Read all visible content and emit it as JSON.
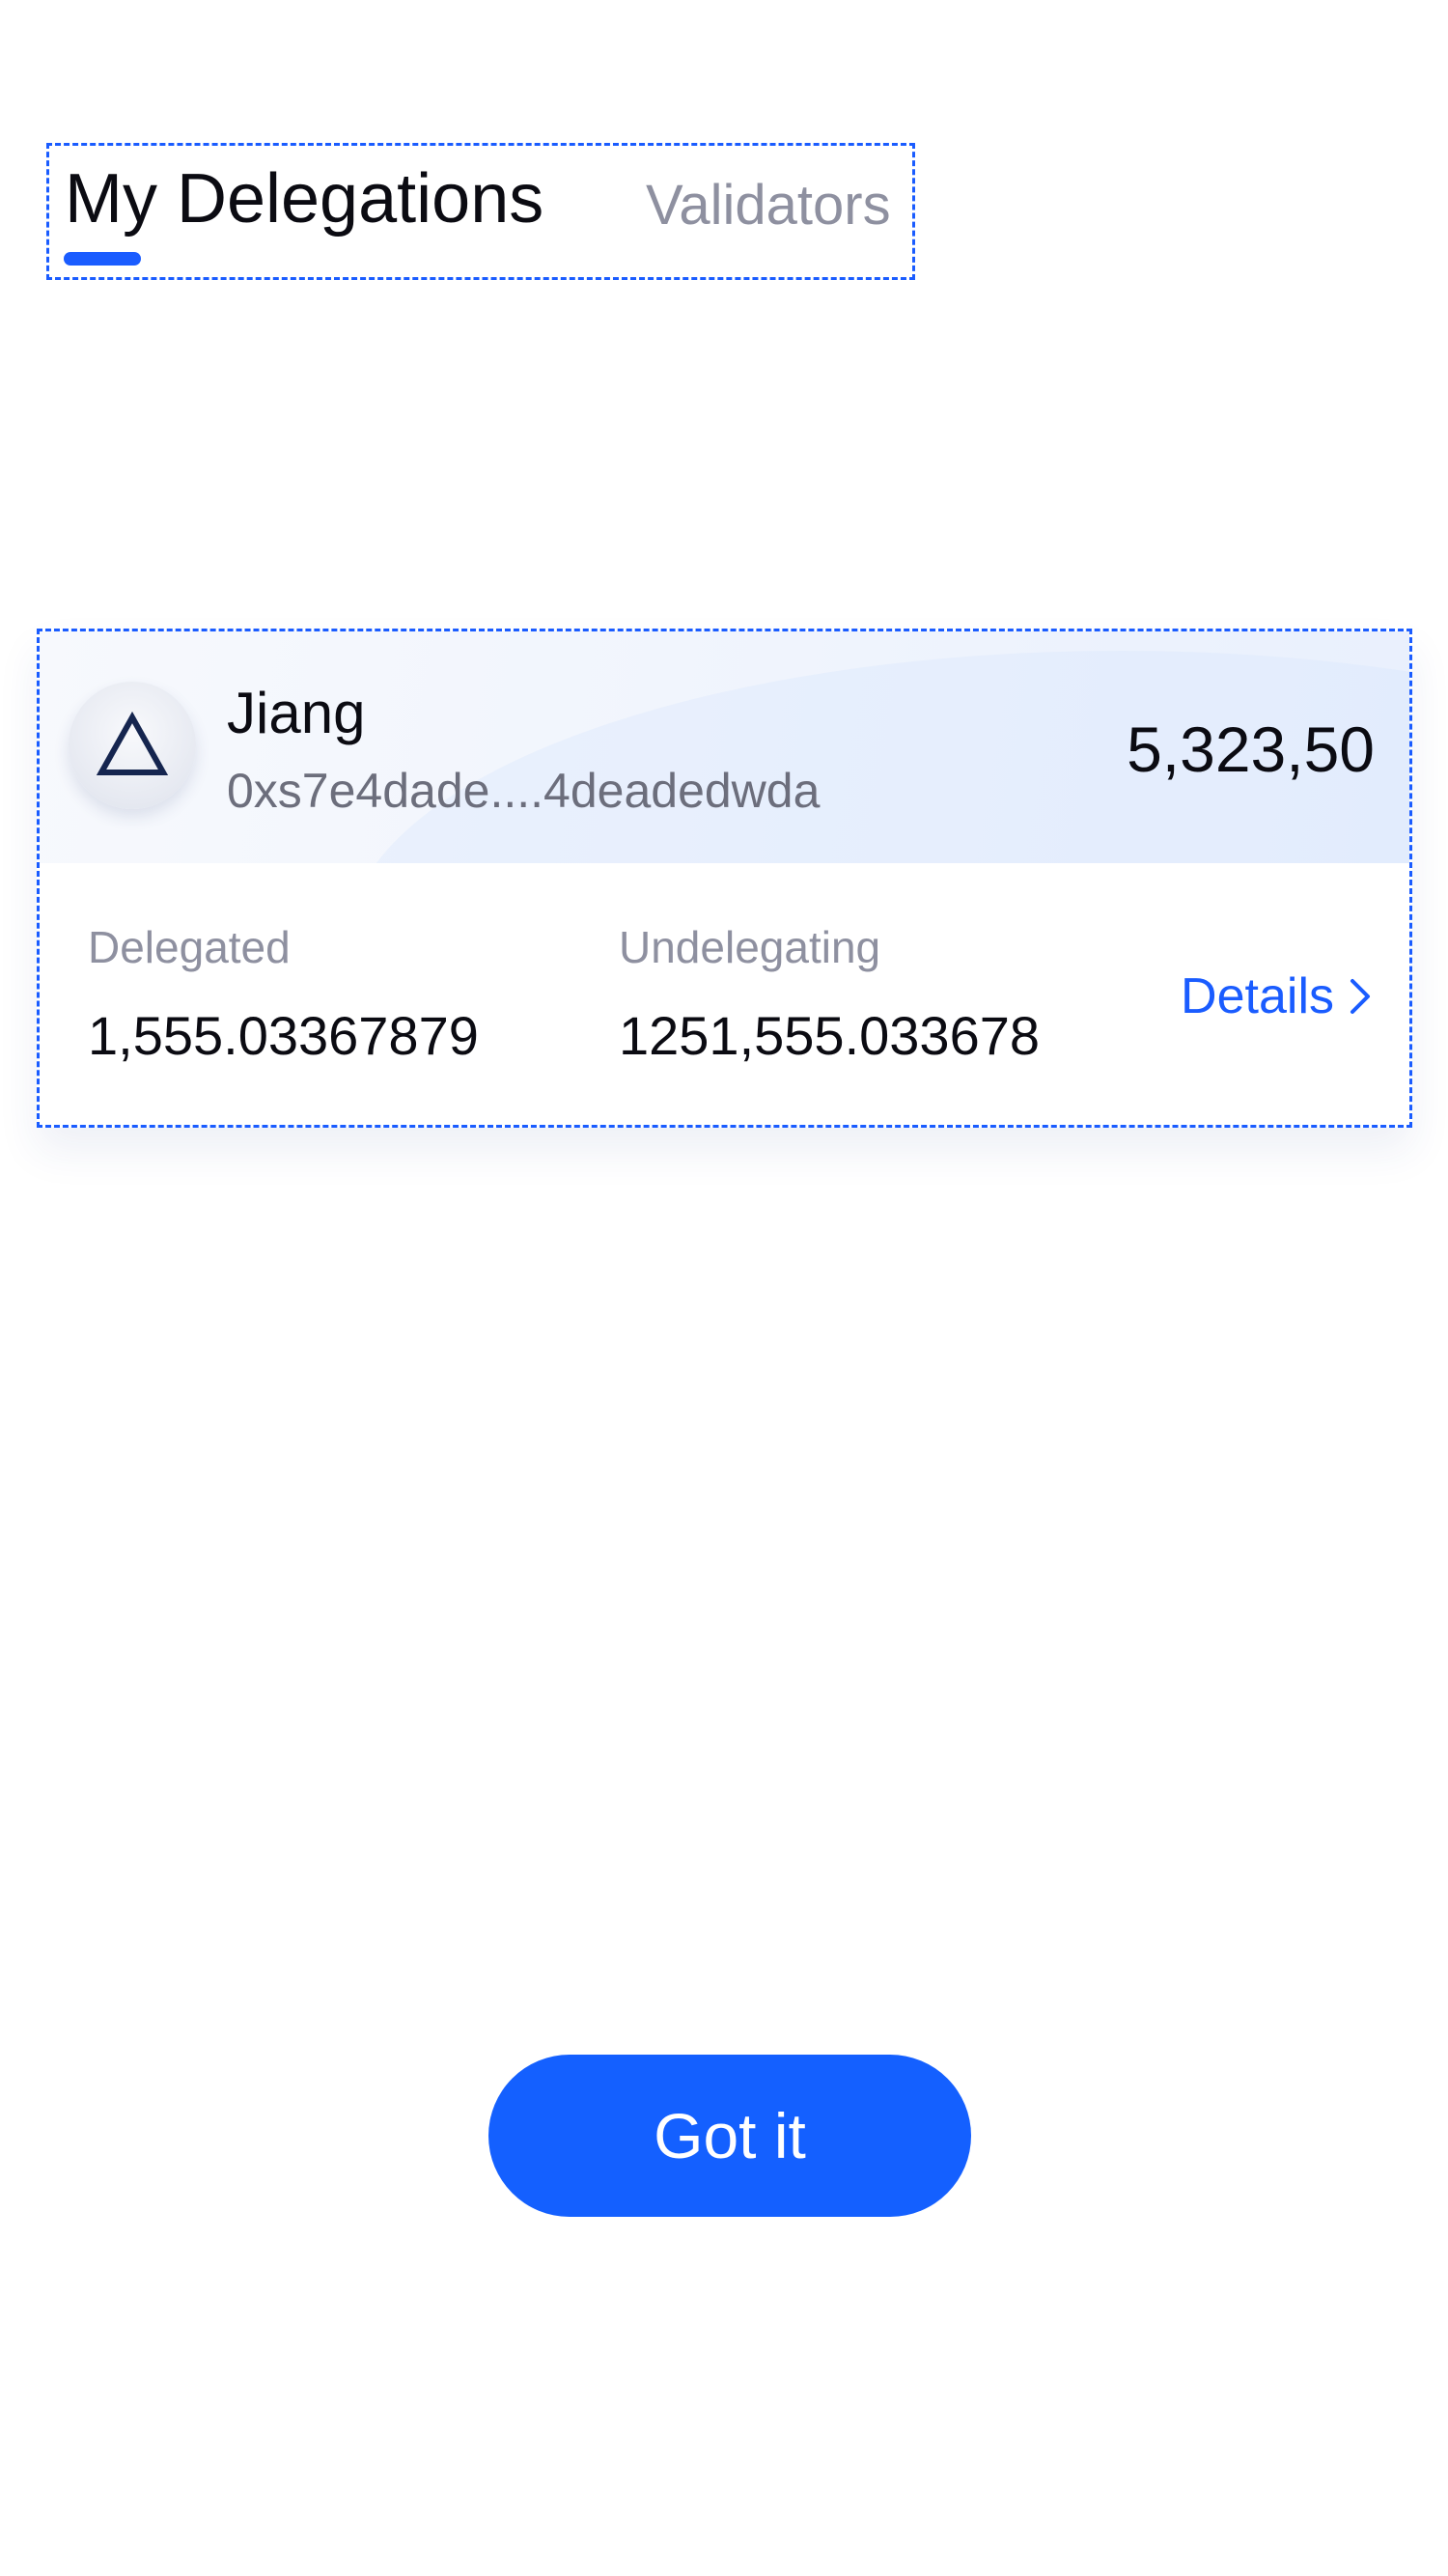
{
  "tabs": {
    "active_label": "My Delegations",
    "inactive_label": "Validators"
  },
  "delegation_card": {
    "name": "Jiang",
    "address": "0xs7e4dade....4deadedwda",
    "amount": "5,323,50",
    "delegated_label": "Delegated",
    "delegated_value": "1,555.03367879",
    "undelegating_label": "Undelegating",
    "undelegating_value": "1251,555.033678",
    "details_label": "Details"
  },
  "actions": {
    "got_it_label": "Got it"
  },
  "icons": {
    "avatar": "triangle-logo-icon",
    "details": "chevron-right-icon"
  },
  "colors": {
    "accent": "#1a5cff",
    "button": "#1460ff",
    "text_primary": "#0b0b12",
    "text_secondary": "#8e90a0"
  }
}
